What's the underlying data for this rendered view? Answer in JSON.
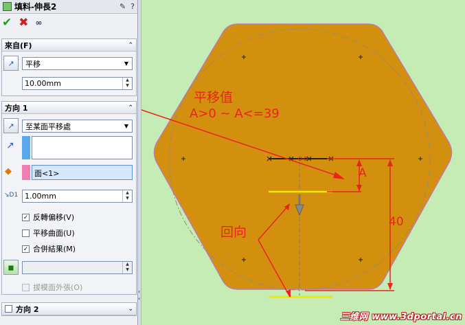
{
  "panel": {
    "title": "填料-伸長2",
    "help_icons": [
      "thumbtack-icon",
      "help-icon"
    ],
    "actions": [
      "ok-icon",
      "cancel-icon",
      "detail-preview-icon"
    ],
    "from_section": {
      "header": "來自(F)",
      "type_value": "平移",
      "offset_value": "10.00mm"
    },
    "direction1": {
      "header": "方向 1",
      "end_condition": "至某面平移處",
      "face_value": "面<1>",
      "depth_value": "1.00mm",
      "options": [
        {
          "label": "反轉偏移(V)",
          "checked": true,
          "enabled": true
        },
        {
          "label": "平移曲面(U)",
          "checked": false,
          "enabled": true
        },
        {
          "label": "合併結果(M)",
          "checked": true,
          "enabled": true
        }
      ],
      "draft_label": "拔模面外張(O)"
    },
    "direction2": {
      "header": "方向 2",
      "checked": false
    }
  },
  "annotations": {
    "offset_title": "平移值",
    "offset_range": "A>0 ~ A<=39",
    "dim_a": "A",
    "dim_40": "40",
    "reverse": "回向"
  },
  "watermark": "三维网 www.3dportal.cn",
  "colors": {
    "background": "#c4ecb4",
    "part_fill": "#d3900f",
    "annotation_red": "#e8241c",
    "highlight_yellow": "#f0e800"
  }
}
